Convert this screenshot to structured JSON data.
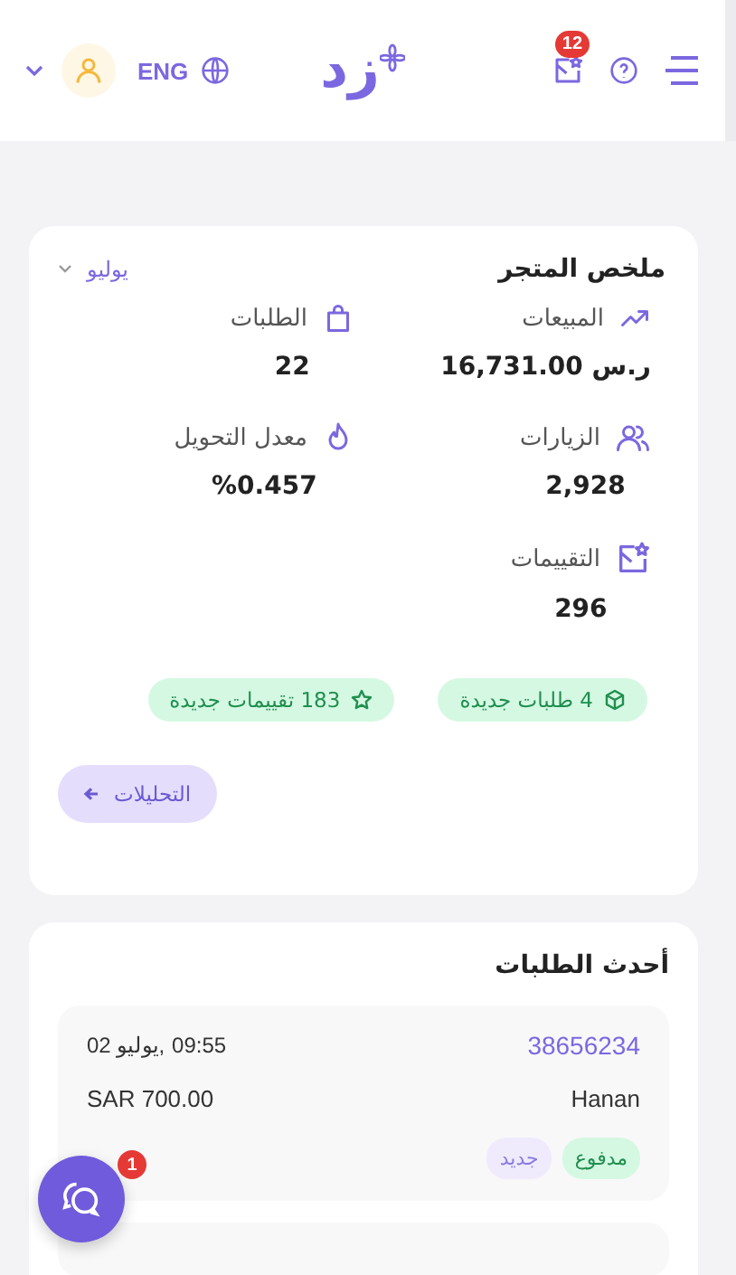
{
  "header": {
    "language": "ENG",
    "logo": "زد",
    "notifications_badge": "12"
  },
  "store_summary": {
    "title": "ملخص المتجر",
    "period": "يوليو",
    "stats": [
      {
        "kind": "sales",
        "label": "المبيعات",
        "value": "ر.س 16,731.00"
      },
      {
        "kind": "orders",
        "label": "الطلبات",
        "value": "22"
      },
      {
        "kind": "visits",
        "label": "الزيارات",
        "value": "2,928"
      },
      {
        "kind": "conversion",
        "label": "معدل التحويل",
        "value": "%0.457"
      },
      {
        "kind": "reviews",
        "label": "التقييمات",
        "value": "296"
      }
    ],
    "chips": [
      {
        "kind": "orders",
        "text": "4 طلبات جديدة"
      },
      {
        "kind": "reviews",
        "text": "183 تقييمات جديدة"
      }
    ],
    "analytics_button": "التحليلات"
  },
  "latest_orders": {
    "title": "أحدث الطلبات",
    "orders": [
      {
        "id": "38656234",
        "date": "02 يوليو,",
        "time": "09:55",
        "customer": "Hanan",
        "total": "SAR 700.00",
        "badges": [
          {
            "kind": "paid",
            "text": "مدفوع"
          },
          {
            "kind": "new",
            "text": "جديد"
          }
        ]
      }
    ]
  },
  "chat": {
    "badge": "1"
  }
}
